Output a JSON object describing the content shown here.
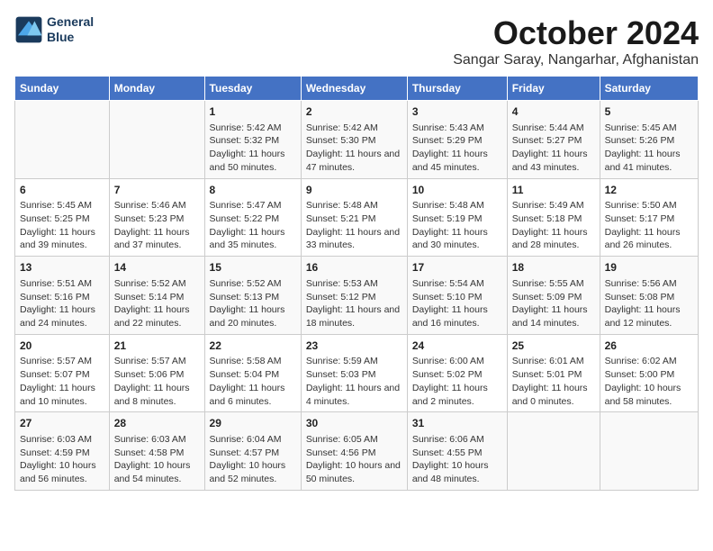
{
  "logo": {
    "line1": "General",
    "line2": "Blue"
  },
  "title": "October 2024",
  "location": "Sangar Saray, Nangarhar, Afghanistan",
  "headers": [
    "Sunday",
    "Monday",
    "Tuesday",
    "Wednesday",
    "Thursday",
    "Friday",
    "Saturday"
  ],
  "weeks": [
    [
      {
        "day": "",
        "info": ""
      },
      {
        "day": "",
        "info": ""
      },
      {
        "day": "1",
        "info": "Sunrise: 5:42 AM\nSunset: 5:32 PM\nDaylight: 11 hours and 50 minutes."
      },
      {
        "day": "2",
        "info": "Sunrise: 5:42 AM\nSunset: 5:30 PM\nDaylight: 11 hours and 47 minutes."
      },
      {
        "day": "3",
        "info": "Sunrise: 5:43 AM\nSunset: 5:29 PM\nDaylight: 11 hours and 45 minutes."
      },
      {
        "day": "4",
        "info": "Sunrise: 5:44 AM\nSunset: 5:27 PM\nDaylight: 11 hours and 43 minutes."
      },
      {
        "day": "5",
        "info": "Sunrise: 5:45 AM\nSunset: 5:26 PM\nDaylight: 11 hours and 41 minutes."
      }
    ],
    [
      {
        "day": "6",
        "info": "Sunrise: 5:45 AM\nSunset: 5:25 PM\nDaylight: 11 hours and 39 minutes."
      },
      {
        "day": "7",
        "info": "Sunrise: 5:46 AM\nSunset: 5:23 PM\nDaylight: 11 hours and 37 minutes."
      },
      {
        "day": "8",
        "info": "Sunrise: 5:47 AM\nSunset: 5:22 PM\nDaylight: 11 hours and 35 minutes."
      },
      {
        "day": "9",
        "info": "Sunrise: 5:48 AM\nSunset: 5:21 PM\nDaylight: 11 hours and 33 minutes."
      },
      {
        "day": "10",
        "info": "Sunrise: 5:48 AM\nSunset: 5:19 PM\nDaylight: 11 hours and 30 minutes."
      },
      {
        "day": "11",
        "info": "Sunrise: 5:49 AM\nSunset: 5:18 PM\nDaylight: 11 hours and 28 minutes."
      },
      {
        "day": "12",
        "info": "Sunrise: 5:50 AM\nSunset: 5:17 PM\nDaylight: 11 hours and 26 minutes."
      }
    ],
    [
      {
        "day": "13",
        "info": "Sunrise: 5:51 AM\nSunset: 5:16 PM\nDaylight: 11 hours and 24 minutes."
      },
      {
        "day": "14",
        "info": "Sunrise: 5:52 AM\nSunset: 5:14 PM\nDaylight: 11 hours and 22 minutes."
      },
      {
        "day": "15",
        "info": "Sunrise: 5:52 AM\nSunset: 5:13 PM\nDaylight: 11 hours and 20 minutes."
      },
      {
        "day": "16",
        "info": "Sunrise: 5:53 AM\nSunset: 5:12 PM\nDaylight: 11 hours and 18 minutes."
      },
      {
        "day": "17",
        "info": "Sunrise: 5:54 AM\nSunset: 5:10 PM\nDaylight: 11 hours and 16 minutes."
      },
      {
        "day": "18",
        "info": "Sunrise: 5:55 AM\nSunset: 5:09 PM\nDaylight: 11 hours and 14 minutes."
      },
      {
        "day": "19",
        "info": "Sunrise: 5:56 AM\nSunset: 5:08 PM\nDaylight: 11 hours and 12 minutes."
      }
    ],
    [
      {
        "day": "20",
        "info": "Sunrise: 5:57 AM\nSunset: 5:07 PM\nDaylight: 11 hours and 10 minutes."
      },
      {
        "day": "21",
        "info": "Sunrise: 5:57 AM\nSunset: 5:06 PM\nDaylight: 11 hours and 8 minutes."
      },
      {
        "day": "22",
        "info": "Sunrise: 5:58 AM\nSunset: 5:04 PM\nDaylight: 11 hours and 6 minutes."
      },
      {
        "day": "23",
        "info": "Sunrise: 5:59 AM\nSunset: 5:03 PM\nDaylight: 11 hours and 4 minutes."
      },
      {
        "day": "24",
        "info": "Sunrise: 6:00 AM\nSunset: 5:02 PM\nDaylight: 11 hours and 2 minutes."
      },
      {
        "day": "25",
        "info": "Sunrise: 6:01 AM\nSunset: 5:01 PM\nDaylight: 11 hours and 0 minutes."
      },
      {
        "day": "26",
        "info": "Sunrise: 6:02 AM\nSunset: 5:00 PM\nDaylight: 10 hours and 58 minutes."
      }
    ],
    [
      {
        "day": "27",
        "info": "Sunrise: 6:03 AM\nSunset: 4:59 PM\nDaylight: 10 hours and 56 minutes."
      },
      {
        "day": "28",
        "info": "Sunrise: 6:03 AM\nSunset: 4:58 PM\nDaylight: 10 hours and 54 minutes."
      },
      {
        "day": "29",
        "info": "Sunrise: 6:04 AM\nSunset: 4:57 PM\nDaylight: 10 hours and 52 minutes."
      },
      {
        "day": "30",
        "info": "Sunrise: 6:05 AM\nSunset: 4:56 PM\nDaylight: 10 hours and 50 minutes."
      },
      {
        "day": "31",
        "info": "Sunrise: 6:06 AM\nSunset: 4:55 PM\nDaylight: 10 hours and 48 minutes."
      },
      {
        "day": "",
        "info": ""
      },
      {
        "day": "",
        "info": ""
      }
    ]
  ]
}
